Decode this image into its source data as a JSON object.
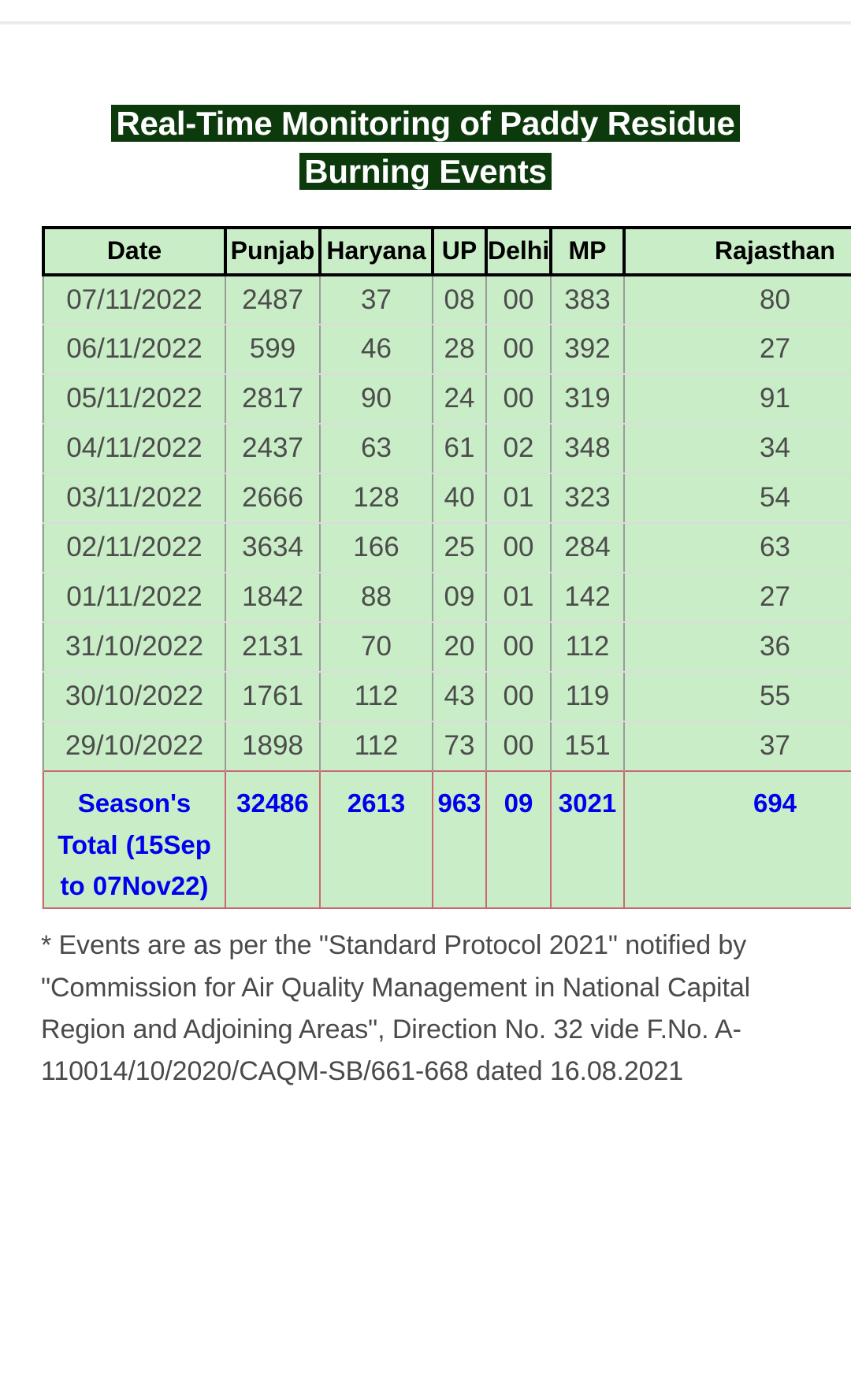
{
  "title": {
    "line1": "Real-Time Monitoring of Paddy Residue",
    "line2": "Burning Events"
  },
  "colors": {
    "title_bg": "#0d3a0d",
    "title_fg": "#ffffff",
    "table_bg": "#c9edc6",
    "header_fg": "#000000",
    "cell_fg": "#4c4c4c",
    "total_fg": "#0000ee",
    "total_border": "#cc6677",
    "footnote_fg": "#4a4a4a"
  },
  "table": {
    "columns": [
      "Date",
      "Punjab",
      "Haryana",
      "UP",
      "Delhi",
      "MP",
      "Rajasthan"
    ],
    "rows": [
      [
        "07/11/2022",
        "2487",
        "37",
        "08",
        "00",
        "383",
        "80"
      ],
      [
        "06/11/2022",
        "599",
        "46",
        "28",
        "00",
        "392",
        "27"
      ],
      [
        "05/11/2022",
        "2817",
        "90",
        "24",
        "00",
        "319",
        "91"
      ],
      [
        "04/11/2022",
        "2437",
        "63",
        "61",
        "02",
        "348",
        "34"
      ],
      [
        "03/11/2022",
        "2666",
        "128",
        "40",
        "01",
        "323",
        "54"
      ],
      [
        "02/11/2022",
        "3634",
        "166",
        "25",
        "00",
        "284",
        "63"
      ],
      [
        "01/11/2022",
        "1842",
        "88",
        "09",
        "01",
        "142",
        "27"
      ],
      [
        "31/10/2022",
        "2131",
        "70",
        "20",
        "00",
        "112",
        "36"
      ],
      [
        "30/10/2022",
        "1761",
        "112",
        "43",
        "00",
        "119",
        "55"
      ],
      [
        "29/10/2022",
        "1898",
        "112",
        "73",
        "00",
        "151",
        "37"
      ]
    ],
    "total_row": [
      "Season's Total (15Sep to 07Nov22)",
      "32486",
      "2613",
      "963",
      "09",
      "3021",
      "694"
    ]
  },
  "footnote": {
    "text": "* Events are as per the \"Standard Protocol 2021\" notified by \"Commission for Air Quality Management in National Capital Region and Adjoining Areas\", Direction No. 32 vide F.No. A-110014/10/2020/CAQM-SB/661-668 dated 16.08.2021"
  },
  "chart_data": {
    "type": "table",
    "title": "Real-Time Monitoring of Paddy Residue Burning Events",
    "columns": [
      "Date",
      "Punjab",
      "Haryana",
      "UP",
      "Delhi",
      "MP",
      "Rajasthan"
    ],
    "rows": [
      {
        "Date": "07/11/2022",
        "Punjab": 2487,
        "Haryana": 37,
        "UP": 8,
        "Delhi": 0,
        "MP": 383,
        "Rajasthan": 80
      },
      {
        "Date": "06/11/2022",
        "Punjab": 599,
        "Haryana": 46,
        "UP": 28,
        "Delhi": 0,
        "MP": 392,
        "Rajasthan": 27
      },
      {
        "Date": "05/11/2022",
        "Punjab": 2817,
        "Haryana": 90,
        "UP": 24,
        "Delhi": 0,
        "MP": 319,
        "Rajasthan": 91
      },
      {
        "Date": "04/11/2022",
        "Punjab": 2437,
        "Haryana": 63,
        "UP": 61,
        "Delhi": 2,
        "MP": 348,
        "Rajasthan": 34
      },
      {
        "Date": "03/11/2022",
        "Punjab": 2666,
        "Haryana": 128,
        "UP": 40,
        "Delhi": 1,
        "MP": 323,
        "Rajasthan": 54
      },
      {
        "Date": "02/11/2022",
        "Punjab": 3634,
        "Haryana": 166,
        "UP": 25,
        "Delhi": 0,
        "MP": 284,
        "Rajasthan": 63
      },
      {
        "Date": "01/11/2022",
        "Punjab": 1842,
        "Haryana": 88,
        "UP": 9,
        "Delhi": 1,
        "MP": 142,
        "Rajasthan": 27
      },
      {
        "Date": "31/10/2022",
        "Punjab": 2131,
        "Haryana": 70,
        "UP": 20,
        "Delhi": 0,
        "MP": 112,
        "Rajasthan": 36
      },
      {
        "Date": "30/10/2022",
        "Punjab": 1761,
        "Haryana": 112,
        "UP": 43,
        "Delhi": 0,
        "MP": 119,
        "Rajasthan": 55
      },
      {
        "Date": "29/10/2022",
        "Punjab": 1898,
        "Haryana": 112,
        "UP": 73,
        "Delhi": 0,
        "MP": 151,
        "Rajasthan": 37
      }
    ],
    "totals": {
      "label": "Season's Total (15Sep to 07Nov22)",
      "Punjab": 32486,
      "Haryana": 2613,
      "UP": 963,
      "Delhi": 9,
      "MP": 3021,
      "Rajasthan": 694
    }
  }
}
